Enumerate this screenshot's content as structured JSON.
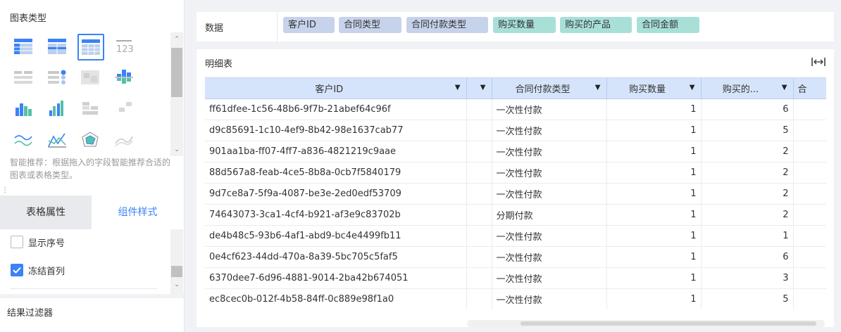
{
  "left_panel": {
    "chart_type_title": "图表类型",
    "chart_type_icons": [
      "table-icon",
      "cross-table-icon",
      "detail-table-icon",
      "kpi-123-icon",
      "filter-list-icon",
      "grouped-list-icon",
      "image-icon",
      "bar-chart-icon",
      "column-chart-icon",
      "grouped-column-icon",
      "stacked-bar-icon",
      "scatter-icon",
      "area-line-icon",
      "line-chart-icon",
      "radar-chart-icon",
      "trend-line-icon"
    ],
    "selected_icon": "detail-table-icon",
    "hint": "智能推荐：根据拖入的字段智能推荐合适的图表或表格类型。",
    "tabs": [
      {
        "label": "表格属性"
      },
      {
        "label": "组件样式"
      }
    ],
    "options": [
      {
        "label": "显示序号",
        "checked": false
      },
      {
        "label": "冻结首列",
        "checked": true
      }
    ],
    "filter_title": "结果过滤器"
  },
  "databar": {
    "label": "数据",
    "dimensions": [
      {
        "label": "客户ID"
      },
      {
        "label": "合同类型"
      },
      {
        "label": "合同付款类型"
      }
    ],
    "measures": [
      {
        "label": "购买数量"
      },
      {
        "label": "购买的产品"
      },
      {
        "label": "合同金额"
      }
    ]
  },
  "detail": {
    "title": "明细表",
    "headers": [
      {
        "label": "客户ID"
      },
      {
        "label": ""
      },
      {
        "label": "合同付款类型"
      },
      {
        "label": "购买数量"
      },
      {
        "label": "购买的..."
      },
      {
        "label": "合"
      }
    ],
    "rows": [
      {
        "id": "ff61dfee-1c56-48b6-9f7b-21abef64c96f",
        "pay": "一次性付款",
        "qty": "1",
        "prod": "6"
      },
      {
        "id": "d9c85691-1c10-4ef9-8b42-98e1637cab77",
        "pay": "一次性付款",
        "qty": "1",
        "prod": "5"
      },
      {
        "id": "901aa1ba-ff07-4ff7-a836-4821219c9aae",
        "pay": "一次性付款",
        "qty": "1",
        "prod": "2"
      },
      {
        "id": "88d567a8-feab-4ce5-8b8a-0cb7f5840179",
        "pay": "一次性付款",
        "qty": "1",
        "prod": "2"
      },
      {
        "id": "9d7ce8a7-5f9a-4087-be3e-2ed0edf53709",
        "pay": "一次性付款",
        "qty": "1",
        "prod": "2"
      },
      {
        "id": "74643073-3ca1-4cf4-b921-af3e9c83702b",
        "pay": "分期付款",
        "qty": "1",
        "prod": "2"
      },
      {
        "id": "de4b48c5-93b6-4af1-abd9-bc4e4499fb11",
        "pay": "一次性付款",
        "qty": "1",
        "prod": "1"
      },
      {
        "id": "0e4cf623-44dd-470a-8a39-5bc705c5faf5",
        "pay": "一次性付款",
        "qty": "1",
        "prod": "6"
      },
      {
        "id": "6370dee7-6d96-4881-9014-2ba42b674051",
        "pay": "一次性付款",
        "qty": "1",
        "prod": "3"
      },
      {
        "id": "ec8cec0b-012f-4b58-84ff-0c889e98f1a0",
        "pay": "一次性付款",
        "qty": "1",
        "prod": "5"
      }
    ]
  },
  "colors": {
    "accent": "#3b82f6",
    "dimension_chip": "#c7d3eb",
    "measure_chip": "#a8e0d8",
    "header_bg": "#d5e4fa"
  }
}
